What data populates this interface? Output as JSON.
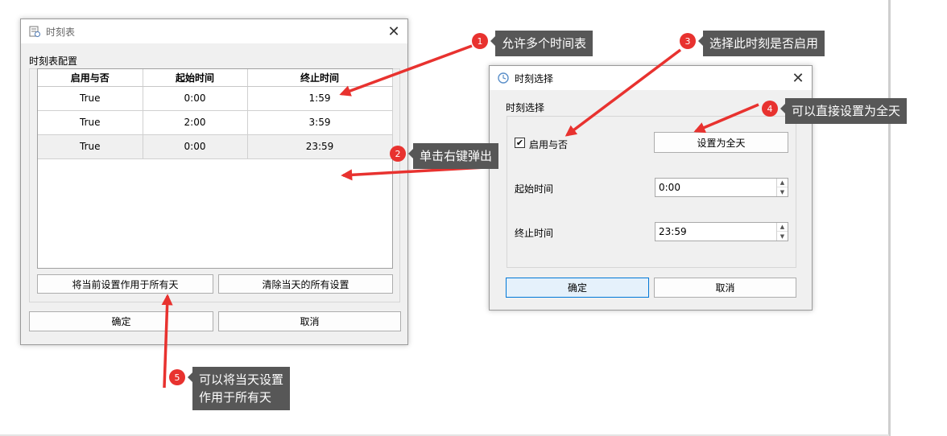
{
  "schedule_dialog": {
    "title": "时刻表",
    "group_label": "时刻表配置",
    "columns": [
      "启用与否",
      "起始时间",
      "终止时间"
    ],
    "rows": [
      {
        "enabled": "True",
        "start": "0:00",
        "end": "1:59"
      },
      {
        "enabled": "True",
        "start": "2:00",
        "end": "3:59"
      },
      {
        "enabled": "True",
        "start": "0:00",
        "end": "23:59"
      }
    ],
    "apply_all_label": "将当前设置作用于所有天",
    "clear_label": "清除当天的所有设置",
    "ok_label": "确定",
    "cancel_label": "取消"
  },
  "time_dialog": {
    "title": "时刻选择",
    "group_label": "时刻选择",
    "enable_label": "启用与否",
    "enable_checked": true,
    "set_all_day_label": "设置为全天",
    "start_label": "起始时间",
    "start_value": "0:00",
    "end_label": "终止时间",
    "end_value": "23:59",
    "ok_label": "确定",
    "cancel_label": "取消"
  },
  "callouts": [
    {
      "num": "1",
      "text": "允许多个时间表"
    },
    {
      "num": "2",
      "text": "单击右键弹出"
    },
    {
      "num": "3",
      "text": "选择此时刻是否启用"
    },
    {
      "num": "4",
      "text": "可以直接设置为全天"
    },
    {
      "num": "5",
      "text": "可以将当天设置\n作用于所有天"
    }
  ],
  "colors": {
    "annotation_arrow": "#e8322f",
    "badge": "#e8322f",
    "callout_bg": "#575757",
    "focus_border": "#0078d7"
  },
  "icons": [
    "schedule-window-icon",
    "time-select-window-icon",
    "close-icon",
    "spin-up-icon",
    "spin-down-icon",
    "check-icon"
  ]
}
